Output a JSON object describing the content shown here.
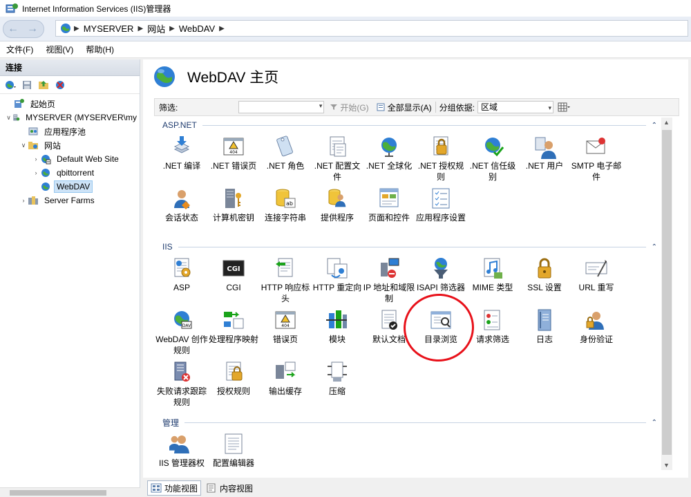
{
  "window": {
    "title": "Internet Information Services (IIS)管理器"
  },
  "address": {
    "crumbs": [
      "MYSERVER",
      "网站",
      "WebDAV"
    ]
  },
  "menu": [
    "文件(F)",
    "视图(V)",
    "帮助(H)"
  ],
  "connections": {
    "header": "连接",
    "tree": [
      {
        "label": "起始页"
      },
      {
        "label": "MYSERVER (MYSERVER\\my"
      },
      {
        "label": "应用程序池"
      },
      {
        "label": "网站"
      },
      {
        "label": "Default Web Site"
      },
      {
        "label": "qbittorrent"
      },
      {
        "label": "WebDAV"
      },
      {
        "label": "Server Farms"
      }
    ]
  },
  "main": {
    "title": "WebDAV 主页",
    "filter": {
      "label": "筛选:",
      "start": "开始(G)",
      "show_all": "全部显示(A)",
      "group_by_label": "分组依据:",
      "group_by_value": "区域"
    },
    "groups": [
      {
        "name": "ASP.NET",
        "features": [
          {
            "label": ".NET 编译",
            "icon": "download-stack-icon"
          },
          {
            "label": ".NET 错误页",
            "icon": "warning-404-icon"
          },
          {
            "label": ".NET 角色",
            "icon": "role-tag-icon"
          },
          {
            "label": ".NET 配置文件",
            "icon": "profile-doc-icon"
          },
          {
            "label": ".NET 全球化",
            "icon": "globe-stand-icon"
          },
          {
            "label": ".NET 授权规则",
            "icon": "lock-doc-icon"
          },
          {
            "label": ".NET 信任级别",
            "icon": "globe-check-icon"
          },
          {
            "label": ".NET 用户",
            "icon": "user-icon"
          },
          {
            "label": "SMTP 电子邮件",
            "icon": "mail-icon"
          },
          {
            "label": "会话状态",
            "icon": "session-user-icon"
          },
          {
            "label": "计算机密钥",
            "icon": "server-key-icon"
          },
          {
            "label": "连接字符串",
            "icon": "db-string-icon"
          },
          {
            "label": "提供程序",
            "icon": "provider-icon"
          },
          {
            "label": "页面和控件",
            "icon": "page-controls-icon"
          },
          {
            "label": "应用程序设置",
            "icon": "app-settings-icon"
          }
        ]
      },
      {
        "name": "IIS",
        "features": [
          {
            "label": "ASP",
            "icon": "asp-gear-icon"
          },
          {
            "label": "CGI",
            "icon": "cgi-icon"
          },
          {
            "label": "HTTP 响应标头",
            "icon": "http-headers-icon"
          },
          {
            "label": "HTTP 重定向",
            "icon": "redirect-icon"
          },
          {
            "label": "IP 地址和域限制",
            "icon": "ip-restrict-icon"
          },
          {
            "label": "ISAPI 筛选器",
            "icon": "filter-funnel-icon"
          },
          {
            "label": "MIME 类型",
            "icon": "mime-media-icon"
          },
          {
            "label": "SSL 设置",
            "icon": "padlock-icon"
          },
          {
            "label": "URL 重写",
            "icon": "url-rewrite-icon"
          },
          {
            "label": "WebDAV 创作规则",
            "icon": "webdav-globe-icon"
          },
          {
            "label": "处理程序映射",
            "icon": "handler-mapping-icon"
          },
          {
            "label": "错误页",
            "icon": "error-page-icon"
          },
          {
            "label": "模块",
            "icon": "modules-icon"
          },
          {
            "label": "默认文档",
            "icon": "default-doc-icon"
          },
          {
            "label": "目录浏览",
            "icon": "directory-browse-icon"
          },
          {
            "label": "请求筛选",
            "icon": "request-filter-icon"
          },
          {
            "label": "日志",
            "icon": "log-book-icon"
          },
          {
            "label": "身份验证",
            "icon": "auth-user-lock-icon"
          },
          {
            "label": "失败请求跟踪规则",
            "icon": "failed-trace-icon"
          },
          {
            "label": "授权规则",
            "icon": "authz-rules-icon"
          },
          {
            "label": "输出缓存",
            "icon": "output-cache-icon"
          },
          {
            "label": "压缩",
            "icon": "compression-icon"
          }
        ]
      },
      {
        "name": "管理",
        "features": [
          {
            "label": "IIS 管理器权限",
            "icon": "mgr-permissions-icon"
          },
          {
            "label": "配置编辑器",
            "icon": "config-editor-icon"
          }
        ]
      }
    ]
  },
  "tabs": {
    "features_view": "功能视图",
    "content_view": "内容视图"
  },
  "colors": {
    "annotation": "#e8111a",
    "group_header": "#1e3b6e",
    "selection": "#cde3f7"
  }
}
